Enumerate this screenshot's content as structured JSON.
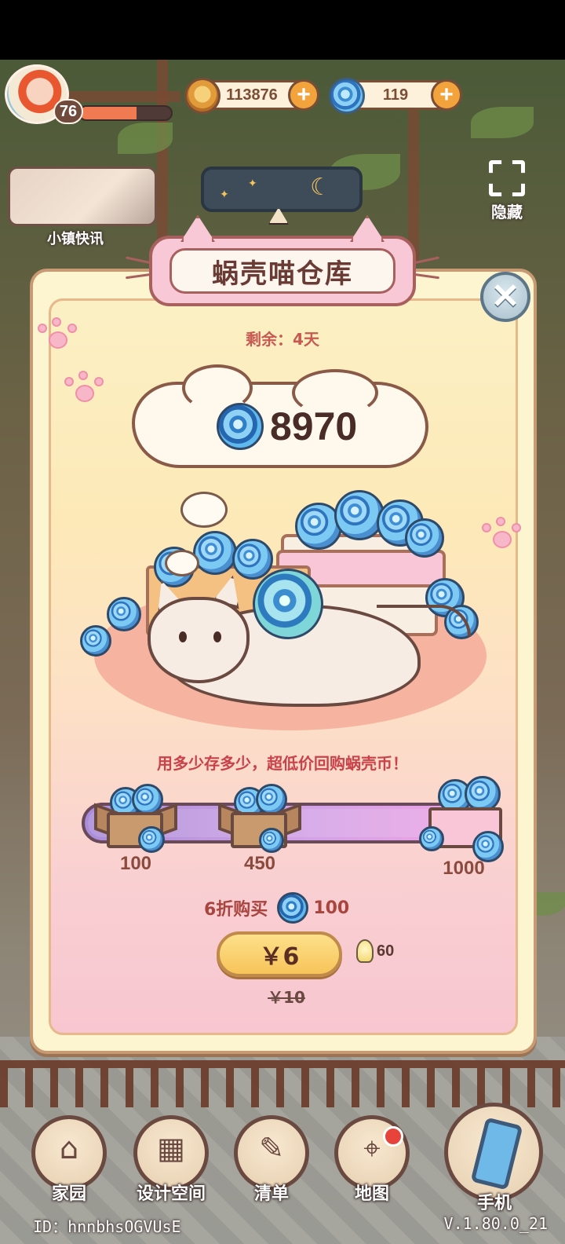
{
  "hud": {
    "level": "76",
    "xp_progress": 0.62,
    "coins": "113876",
    "shells": "119",
    "hide_label": "隐藏",
    "news_label": "小镇快讯"
  },
  "modal": {
    "title": "蜗壳喵仓库",
    "remaining": "剩余：4天",
    "stored_amount": "8970",
    "promo_text": "用多少存多少，超低价回购蜗壳币！",
    "tiers": [
      {
        "amount": "100"
      },
      {
        "amount": "450"
      },
      {
        "amount": "1000"
      }
    ],
    "tier_progress": 1.0,
    "discount_label": "6折购买",
    "discount_shells": "100",
    "buy_price": "￥6",
    "bulb_reward": "60",
    "original_price": "￥10"
  },
  "nav": {
    "home": "家园",
    "design": "设计空间",
    "list": "清单",
    "map": "地图",
    "phone": "手机"
  },
  "footer": {
    "id": "ID：hnnbhsOGVUsE",
    "version": "V.1.80.0_21"
  },
  "colors": {
    "accent_pink": "#f8c8d6",
    "title_brown": "#6a3a34",
    "promo_red": "#c9424a",
    "button_yellow": "#f7c45a"
  }
}
